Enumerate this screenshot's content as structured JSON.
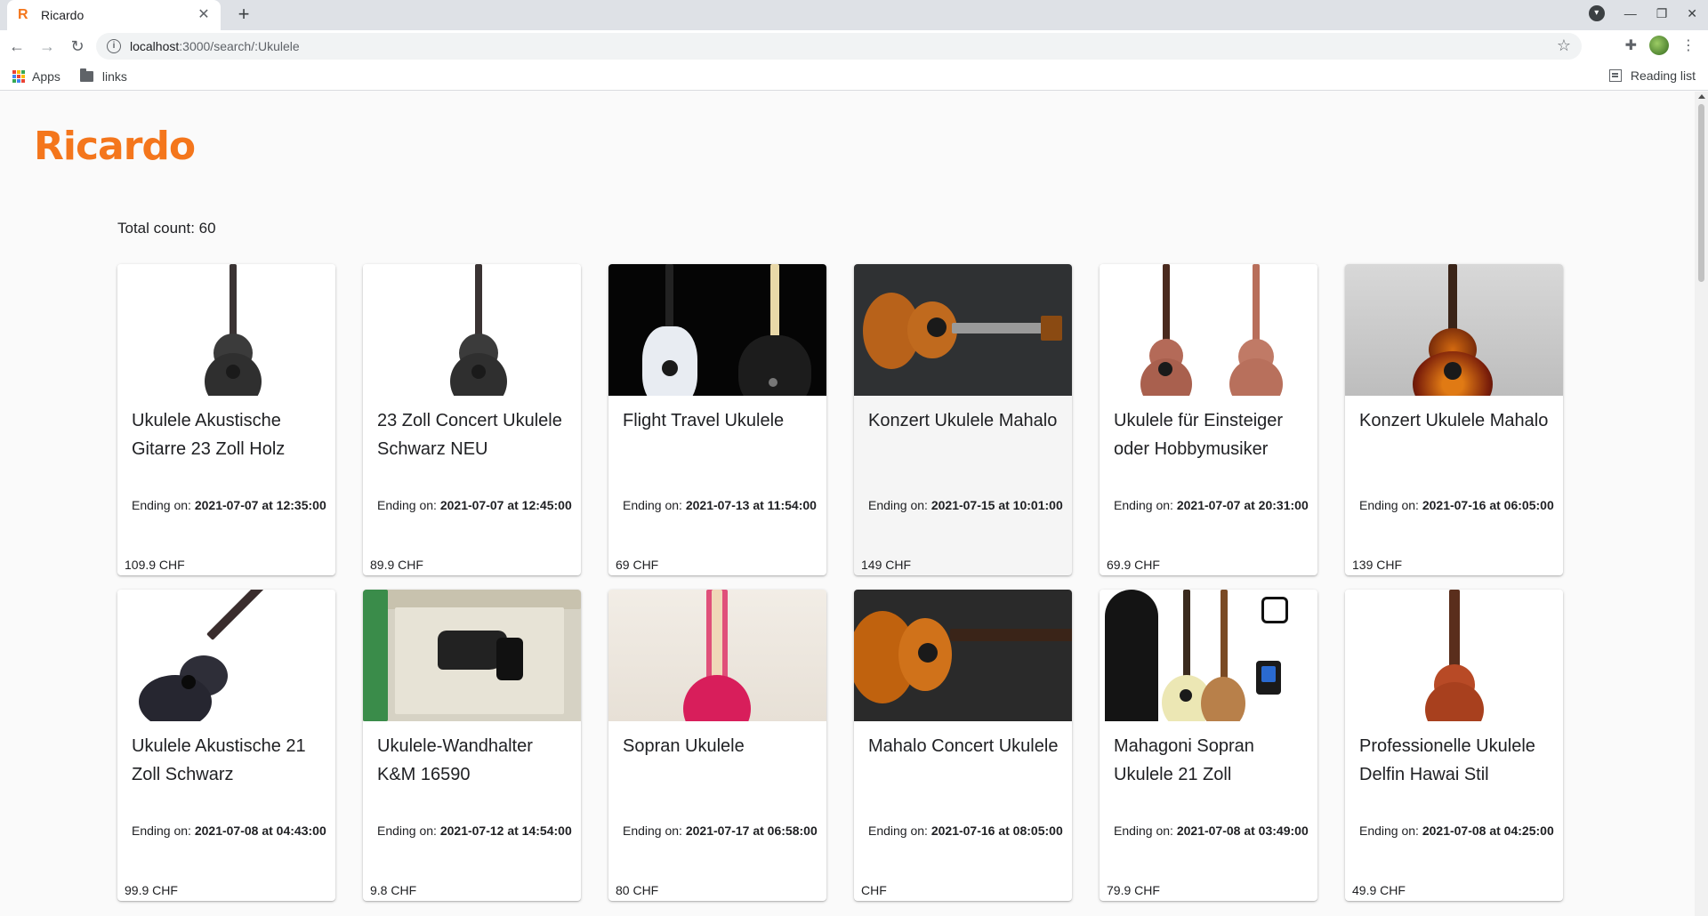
{
  "browser": {
    "tab_title": "Ricardo",
    "tab_favicon": "R",
    "url_host": "localhost",
    "url_path": ":3000/search/:Ukulele",
    "bookmarks": [
      {
        "label": "Apps",
        "icon": "apps-grid-icon"
      },
      {
        "label": "links",
        "icon": "folder-icon"
      }
    ],
    "reading_list": "Reading list"
  },
  "page": {
    "logo": "Ricardo",
    "total_label": "Total count: 60",
    "ending_prefix": "Ending on: ",
    "accent_color": "#f4761c"
  },
  "listings": [
    {
      "title": "Ukulele Akustische Gitarre 23 Zoll Holz",
      "ending": "2021-07-07 at 12:35:00",
      "price": "109.9 CHF",
      "image": "dark-ukulele-white-bg"
    },
    {
      "title": "23 Zoll Concert Ukulele Schwarz NEU",
      "ending": "2021-07-07 at 12:45:00",
      "price": "89.9 CHF",
      "image": "dark-ukulele-white-bg"
    },
    {
      "title": "Flight Travel Ukulele",
      "ending": "2021-07-13 at 11:54:00",
      "price": "69 CHF",
      "image": "white-and-black-ukuleles-black-bg"
    },
    {
      "title": "Konzert Ukulele Mahalo",
      "ending": "2021-07-15 at 10:01:00",
      "price": "149 CHF",
      "image": "brown-ukulele-horizontal-grey-bg"
    },
    {
      "title": "Ukulele für Einsteiger oder Hobbymusiker",
      "ending": "2021-07-07 at 20:31:00",
      "price": "69.9 CHF",
      "image": "two-mahogany-ukuleles"
    },
    {
      "title": "Konzert Ukulele Mahalo",
      "ending": "2021-07-16 at 06:05:00",
      "price": "139 CHF",
      "image": "sunburst-ukulele"
    },
    {
      "title": "Ukulele Akustische 21 Zoll Schwarz",
      "ending": "2021-07-08 at 04:43:00",
      "price": "99.9 CHF",
      "image": "black-ukulele-diagonal"
    },
    {
      "title": "Ukulele-Wandhalter K&M 16590",
      "ending": "2021-07-12 at 14:54:00",
      "price": "9.8 CHF",
      "image": "wall-holder-box"
    },
    {
      "title": "Sopran Ukulele",
      "ending": "2021-07-17 at 06:58:00",
      "price": "80 CHF",
      "image": "pink-ukulele"
    },
    {
      "title": "Mahalo Concert Ukulele",
      "ending": "2021-07-16 at 08:05:00",
      "price": "CHF",
      "image": "orange-ukulele-horizontal"
    },
    {
      "title": "Mahagoni Sopran Ukulele 21 Zoll",
      "ending": "2021-07-08 at 03:49:00",
      "price": "79.9 CHF",
      "image": "ukulele-set-with-bag-capo-tuner"
    },
    {
      "title": "Professionelle Ukulele Delfin Hawai Stil",
      "ending": "2021-07-08 at 04:25:00",
      "price": "49.9 CHF",
      "image": "red-ukulele-white-bg"
    }
  ]
}
